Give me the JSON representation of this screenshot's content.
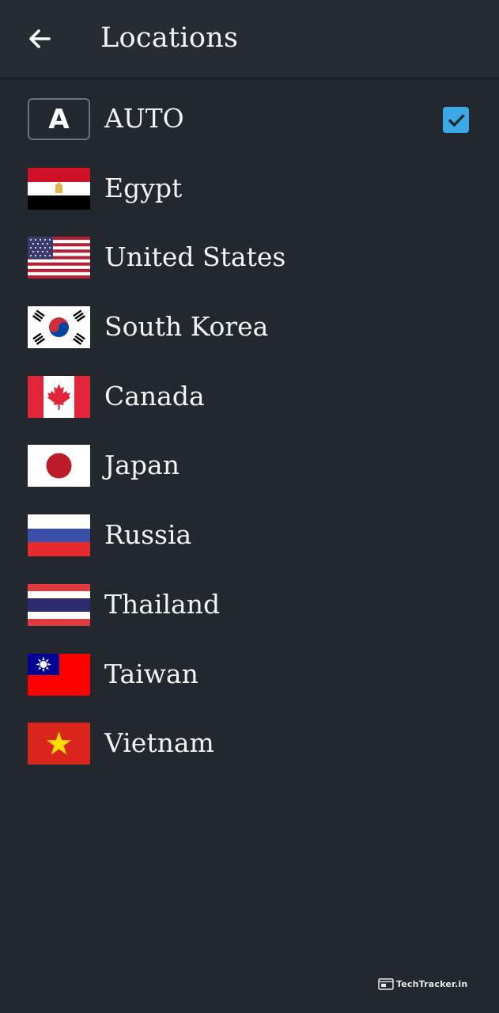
{
  "header": {
    "title": "Locations",
    "back_icon": "arrow-left-icon"
  },
  "locations": [
    {
      "label": "AUTO",
      "flag": "auto-badge",
      "badge_text": "A",
      "selected": true
    },
    {
      "label": "Egypt",
      "flag": "egypt-flag",
      "selected": false
    },
    {
      "label": "United States",
      "flag": "usa-flag",
      "selected": false
    },
    {
      "label": "South Korea",
      "flag": "south-korea-flag",
      "selected": false
    },
    {
      "label": "Canada",
      "flag": "canada-flag",
      "selected": false
    },
    {
      "label": "Japan",
      "flag": "japan-flag",
      "selected": false
    },
    {
      "label": "Russia",
      "flag": "russia-flag",
      "selected": false
    },
    {
      "label": "Thailand",
      "flag": "thailand-flag",
      "selected": false
    },
    {
      "label": "Taiwan",
      "flag": "taiwan-flag",
      "selected": false
    },
    {
      "label": "Vietnam",
      "flag": "vietnam-flag",
      "selected": false
    }
  ],
  "colors": {
    "background": "#23272e",
    "appbar": "#272b32",
    "checkbox": "#3aa9e6"
  },
  "watermark": {
    "text": "TechTracker.in"
  }
}
